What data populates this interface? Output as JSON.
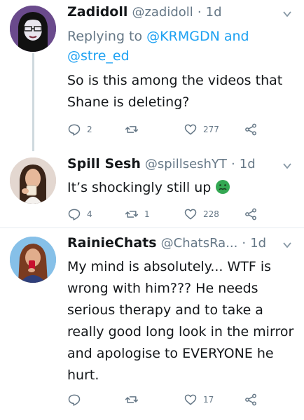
{
  "tweets": [
    {
      "name": "Zadidoll",
      "handle": "@zadidoll",
      "time": "1d",
      "replying_prefix": "Replying to",
      "replying_mention1": "@KRMGDN",
      "replying_and": "and",
      "replying_mention2": "@stre_ed",
      "text": "So is this among the videos that Shane is deleting?",
      "replies": "2",
      "retweets": "",
      "likes": "277"
    },
    {
      "name": "Spill Sesh",
      "handle": "@spillseshYT",
      "time": "1d",
      "text": "It’s shockingly still up",
      "emoji": "nauseated-face-emoji",
      "replies": "4",
      "retweets": "1",
      "likes": "228"
    },
    {
      "name": "RainieChats",
      "handle": "@ChatsRa...",
      "time": "1d",
      "text": "My mind is absolutely... WTF is wrong with him??? He needs serious therapy and to take a really good long look in the mirror and apologise to EVERYONE he hurt.",
      "replies": "",
      "retweets": "",
      "likes": "17"
    }
  ],
  "colors": {
    "link": "#1da1f2",
    "secondary": "#657786",
    "divider": "#e6ecf0",
    "emoji_green": "#34a853"
  },
  "icons": {
    "reply": "reply-icon",
    "retweet": "retweet-icon",
    "like": "heart-icon",
    "share": "share-icon",
    "menu": "chevron-down-icon"
  }
}
